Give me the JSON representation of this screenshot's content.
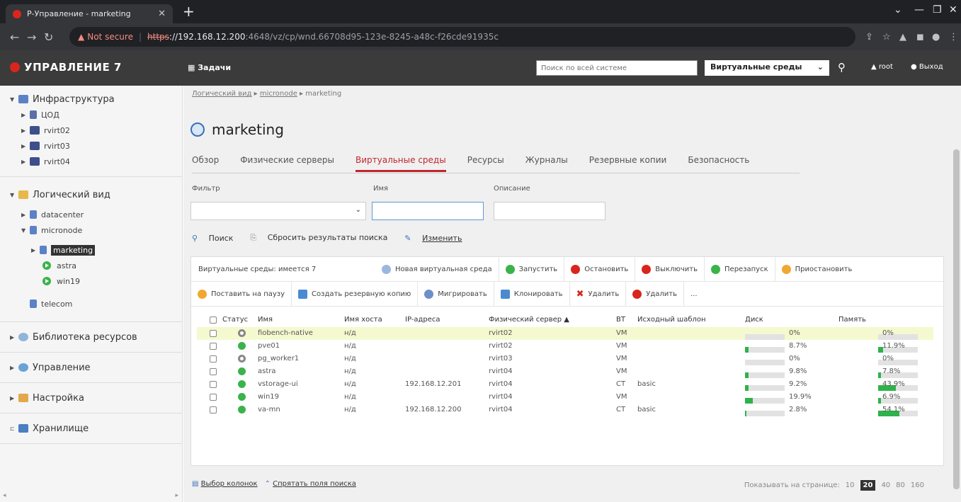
{
  "browser": {
    "tab_title": "Р-Управление - marketing",
    "new_tab": "+",
    "url_warn": "Not secure",
    "url_scheme": "https",
    "url_host": "://192.168.12.200",
    "url_rest": ":4648/vz/cp/wnd.66708d95-123e-8245-a48c-f26cde91935c"
  },
  "header": {
    "logo": "УПРАВЛЕНИЕ 7",
    "tasks": "Задачи",
    "search_placeholder": "Поиск по всей системе",
    "scope": "Виртуальные среды",
    "user": "root",
    "logout": "Выход"
  },
  "sidebar": {
    "infra": "Инфраструктура",
    "infra_items": [
      "ЦОД",
      "rvirt02",
      "rvirt03",
      "rvirt04"
    ],
    "logical": "Логический вид",
    "datacenter": "datacenter",
    "micronode": "micronode",
    "marketing": "marketing",
    "astra": "astra",
    "win19": "win19",
    "telecom": "telecom",
    "library": "Библиотека ресурсов",
    "management": "Управление",
    "settings": "Настройка",
    "storage": "Хранилище"
  },
  "main": {
    "breadcrumb_root": "Логический вид",
    "breadcrumb_mid": "micronode",
    "breadcrumb_leaf": "marketing",
    "title": "marketing",
    "tabs": [
      "Обзор",
      "Физические серверы",
      "Виртуальные среды",
      "Ресурсы",
      "Журналы",
      "Резервные копии",
      "Безопасность"
    ],
    "filter_label": "Фильтр",
    "name_label": "Имя",
    "desc_label": "Описание",
    "search": "Поиск",
    "reset": "Сбросить результаты поиска",
    "change": "Изменить"
  },
  "toolbar": {
    "count": "Виртуальные среды: имеется 7",
    "new": "Новая виртуальная среда",
    "start": "Запустить",
    "stop": "Остановить",
    "poweroff": "Выключить",
    "restart": "Перезапуск",
    "suspend": "Приостановить",
    "pause": "Поставить на паузу",
    "backup": "Создать резервную копию",
    "migrate": "Мигрировать",
    "clone": "Клонировать",
    "delete1": "Удалить",
    "delete2": "Удалить",
    "more": "..."
  },
  "table": {
    "headers": {
      "status": "Статус",
      "name": "Имя",
      "host": "Имя хоста",
      "ip": "IP-адреса",
      "server": "Физический сервер ▲",
      "vt": "ВТ",
      "template": "Исходный шаблон",
      "disk": "Диск",
      "mem": "Память"
    },
    "rows": [
      {
        "name": "fiobench-native",
        "host": "н/д",
        "ip": "",
        "server": "rvirt02",
        "vt": "VM",
        "template": "",
        "disk": "0%",
        "mem": "0%"
      },
      {
        "name": "pve01",
        "host": "н/д",
        "ip": "",
        "server": "rvirt02",
        "vt": "VM",
        "template": "",
        "disk": "8.7%",
        "mem": "11.9%"
      },
      {
        "name": "pg_worker1",
        "host": "н/д",
        "ip": "",
        "server": "rvirt03",
        "vt": "VM",
        "template": "",
        "disk": "0%",
        "mem": "0%"
      },
      {
        "name": "astra",
        "host": "н/д",
        "ip": "",
        "server": "rvirt04",
        "vt": "VM",
        "template": "",
        "disk": "9.8%",
        "mem": "7.8%"
      },
      {
        "name": "vstorage-ui",
        "host": "н/д",
        "ip": "192.168.12.201",
        "server": "rvirt04",
        "vt": "CT",
        "template": "basic",
        "disk": "9.2%",
        "mem": "43.9%"
      },
      {
        "name": "win19",
        "host": "н/д",
        "ip": "",
        "server": "rvirt04",
        "vt": "VM",
        "template": "",
        "disk": "19.9%",
        "mem": "6.9%"
      },
      {
        "name": "va-mn",
        "host": "н/д",
        "ip": "192.168.12.200",
        "server": "rvirt04",
        "vt": "CT",
        "template": "basic",
        "disk": "2.8%",
        "mem": "54.1%"
      }
    ],
    "status": [
      "stop",
      "run",
      "stop",
      "run",
      "run",
      "run",
      "run"
    ],
    "disk_fraction": [
      0,
      0.087,
      0,
      0.098,
      0.092,
      0.199,
      0.028
    ],
    "mem_fraction": [
      0,
      0.119,
      0,
      0.078,
      0.439,
      0.069,
      0.541
    ]
  },
  "footer": {
    "columns": "Выбор колонок",
    "hide": "Спрятать поля поиска",
    "per_page": "Показывать на странице:",
    "sizes": [
      "10",
      "20",
      "40",
      "80",
      "160"
    ]
  }
}
